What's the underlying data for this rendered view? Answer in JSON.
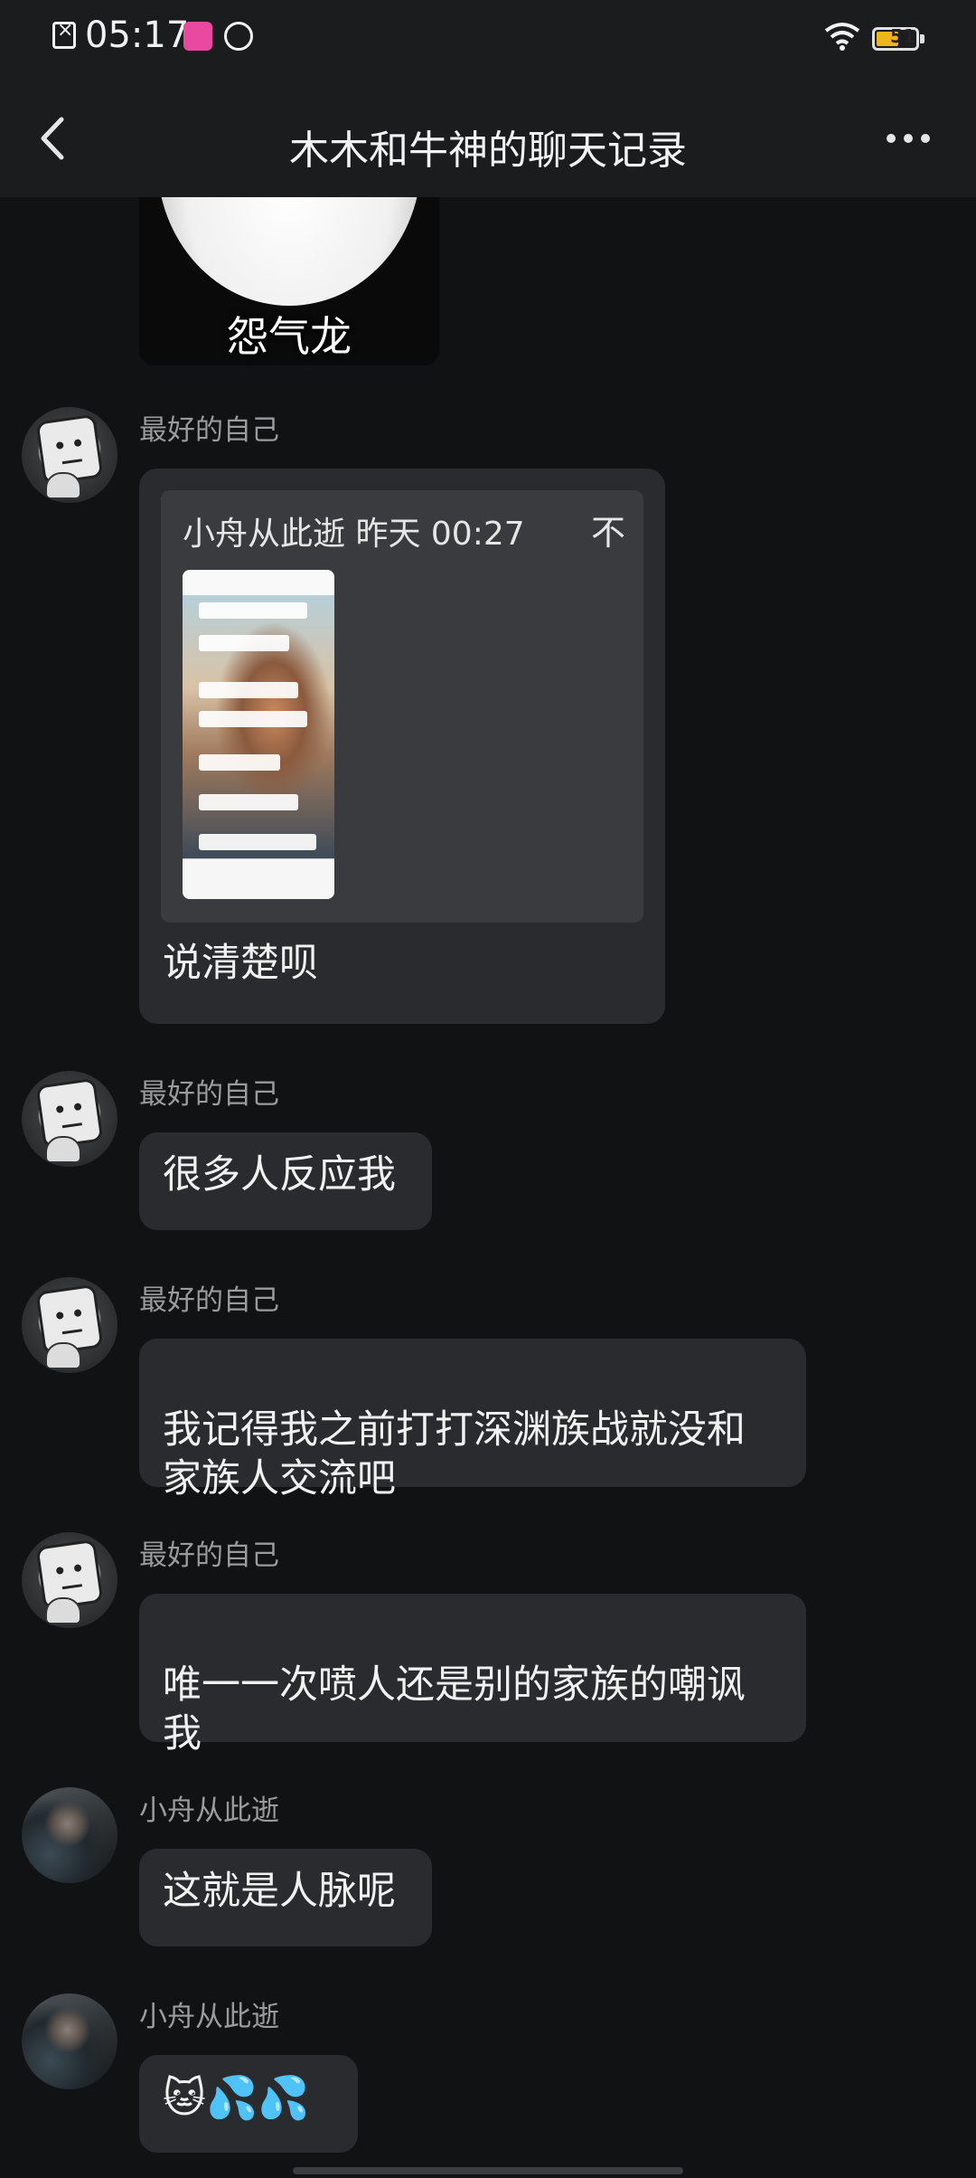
{
  "status_bar": {
    "time": "05:17",
    "battery_level": "51",
    "icons": [
      "file-error-icon",
      "app-notification-icon",
      "app-notification-icon-2",
      "wifi-icon",
      "battery-icon"
    ]
  },
  "header": {
    "title": "木木和牛神的聊天记录",
    "back_icon": "chevron-left-icon",
    "more_icon": "more-horizontal-icon"
  },
  "sticker": {
    "caption": "怨气龙"
  },
  "messages": [
    {
      "sender": "最好的自己",
      "quote": {
        "author_time": "小舟从此逝 昨天 00:27",
        "collapse_icon": "不"
      },
      "text": "说清楚呗"
    },
    {
      "sender": "最好的自己",
      "text": "很多人反应我"
    },
    {
      "sender": "最好的自己",
      "text": "我记得我之前打打深渊族战就没和\n家族人交流吧"
    },
    {
      "sender": "最好的自己",
      "text": "唯一一次喷人还是别的家族的嘲讽\n我"
    },
    {
      "sender": "小舟从此逝",
      "text": "这就是人脉呢"
    },
    {
      "sender": "小舟从此逝",
      "text": "🐱💦💦"
    }
  ]
}
